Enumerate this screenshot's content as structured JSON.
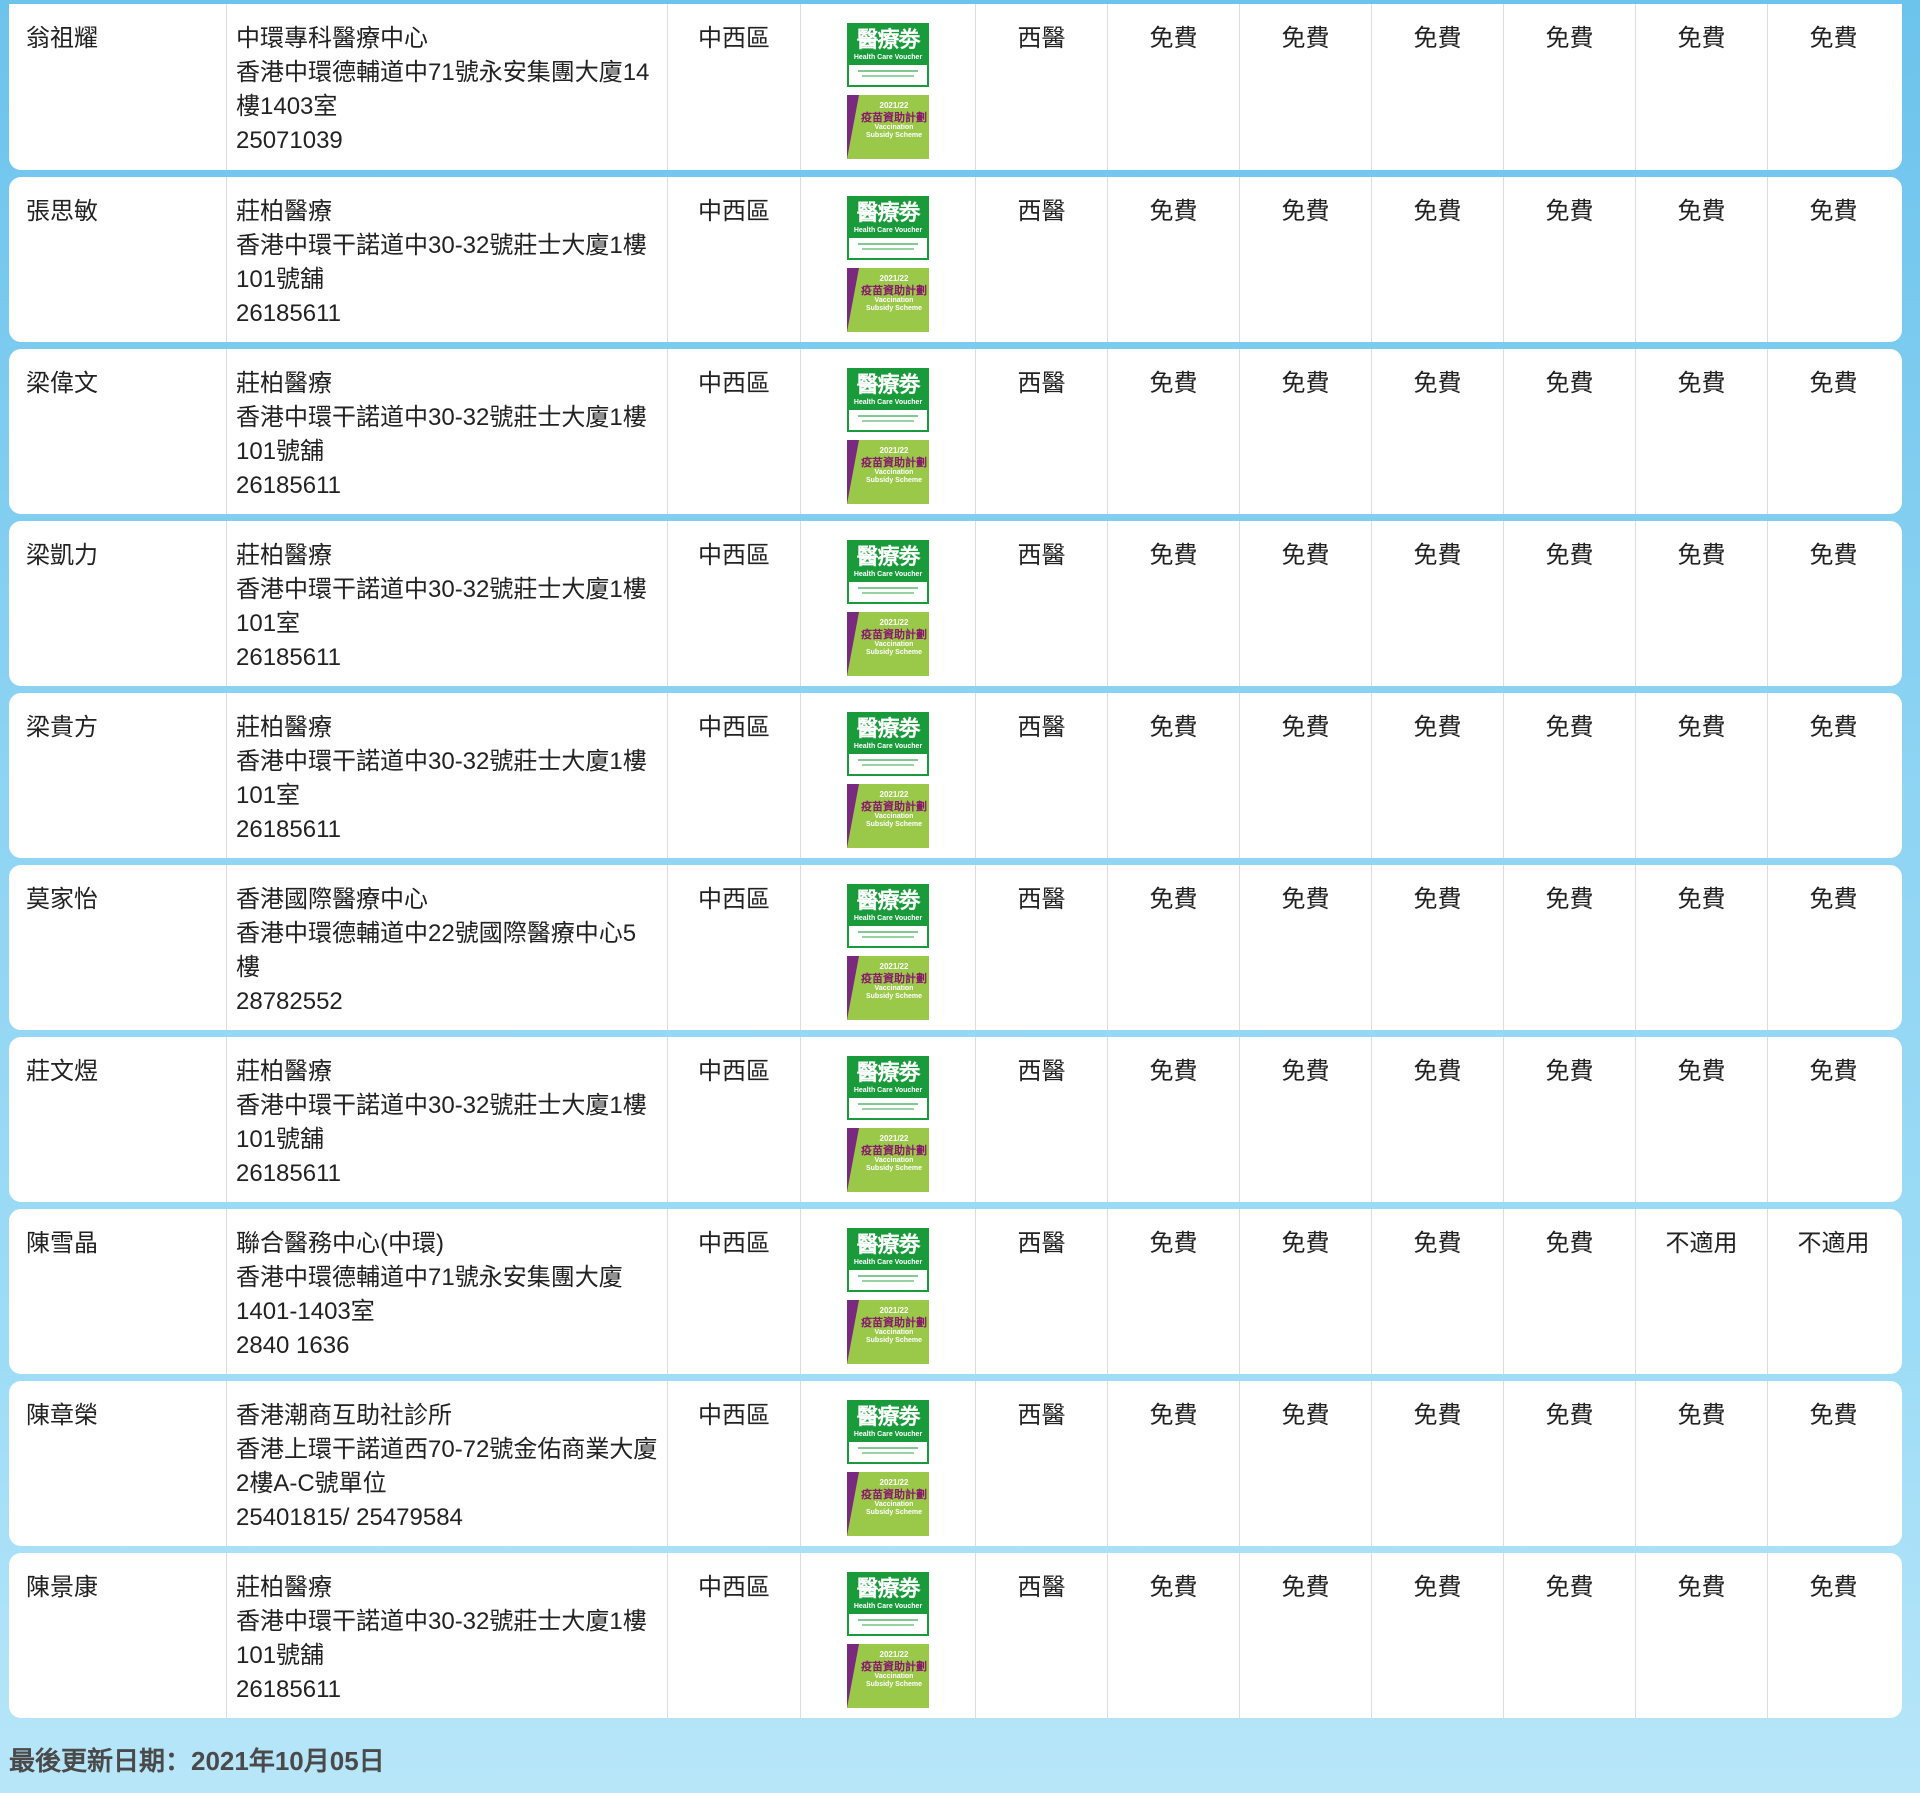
{
  "rows": [
    {
      "name": "翁祖耀",
      "clinic": "中環專科醫療中心",
      "address1": "香港中環德輔道中71號永安集團大廈14",
      "address2": "樓1403室",
      "phone": "25071039",
      "district": "中西區",
      "type": "西醫",
      "fees": [
        "免費",
        "免費",
        "免費",
        "免費",
        "免費",
        "免費"
      ]
    },
    {
      "name": "張思敏",
      "clinic": "莊柏醫療",
      "address1": "香港中環干諾道中30-32號莊士大廈1樓",
      "address2": "101號舖",
      "phone": "26185611",
      "district": "中西區",
      "type": "西醫",
      "fees": [
        "免費",
        "免費",
        "免費",
        "免費",
        "免費",
        "免費"
      ]
    },
    {
      "name": "梁偉文",
      "clinic": "莊柏醫療",
      "address1": "香港中環干諾道中30-32號莊士大廈1樓",
      "address2": "101號舖",
      "phone": "26185611",
      "district": "中西區",
      "type": "西醫",
      "fees": [
        "免費",
        "免費",
        "免費",
        "免費",
        "免費",
        "免費"
      ]
    },
    {
      "name": "梁凱力",
      "clinic": "莊柏醫療",
      "address1": "香港中環干諾道中30-32號莊士大廈1樓",
      "address2": "101室",
      "phone": "26185611",
      "district": "中西區",
      "type": "西醫",
      "fees": [
        "免費",
        "免費",
        "免費",
        "免費",
        "免費",
        "免費"
      ]
    },
    {
      "name": "梁貴方",
      "clinic": "莊柏醫療",
      "address1": "香港中環干諾道中30-32號莊士大廈1樓",
      "address2": "101室",
      "phone": "26185611",
      "district": "中西區",
      "type": "西醫",
      "fees": [
        "免費",
        "免費",
        "免費",
        "免費",
        "免費",
        "免費"
      ]
    },
    {
      "name": "莫家怡",
      "clinic": "香港國際醫療中心",
      "address1": "香港中環德輔道中22號國際醫療中心5",
      "address2": "樓",
      "phone": "28782552",
      "district": "中西區",
      "type": "西醫",
      "fees": [
        "免費",
        "免費",
        "免費",
        "免費",
        "免費",
        "免費"
      ]
    },
    {
      "name": "莊文煜",
      "clinic": "莊柏醫療",
      "address1": "香港中環干諾道中30-32號莊士大廈1樓",
      "address2": "101號舖",
      "phone": "26185611",
      "district": "中西區",
      "type": "西醫",
      "fees": [
        "免費",
        "免費",
        "免費",
        "免費",
        "免費",
        "免費"
      ]
    },
    {
      "name": "陳雪晶",
      "clinic": "聯合醫務中心(中環)",
      "address1": "香港中環德輔道中71號永安集團大廈",
      "address2": "1401-1403室",
      "phone": "2840 1636",
      "district": "中西區",
      "type": "西醫",
      "fees": [
        "免費",
        "免費",
        "免費",
        "免費",
        "不適用",
        "不適用"
      ]
    },
    {
      "name": "陳章榮",
      "clinic": "香港潮商互助社診所",
      "address1": "香港上環干諾道西70-72號金佑商業大廈",
      "address2": "2樓A-C號單位",
      "phone": "25401815/ 25479584",
      "district": "中西區",
      "type": "西醫",
      "fees": [
        "免費",
        "免費",
        "免費",
        "免費",
        "免費",
        "免費"
      ]
    },
    {
      "name": "陳景康",
      "clinic": "莊柏醫療",
      "address1": "香港中環干諾道中30-32號莊士大廈1樓",
      "address2": "101號舖",
      "phone": "26185611",
      "district": "中西區",
      "type": "西醫",
      "fees": [
        "免費",
        "免費",
        "免費",
        "免費",
        "免費",
        "免費"
      ]
    }
  ],
  "badges": {
    "hcv_title": "醫療劵",
    "hcv_sub": "Health Care Voucher",
    "vss_year": "2021/22",
    "vss_title": "疫苗資助計劃",
    "vss_en1": "Vaccination",
    "vss_en2": "Subsidy Scheme"
  },
  "footer": {
    "updated": "最後更新日期：2021年10月05日"
  },
  "colors": {
    "hcv_green": "#1a9b3b",
    "vss_green": "#9ac94a",
    "vss_purple": "#7a2a7e",
    "background": "#8fd4f3"
  }
}
